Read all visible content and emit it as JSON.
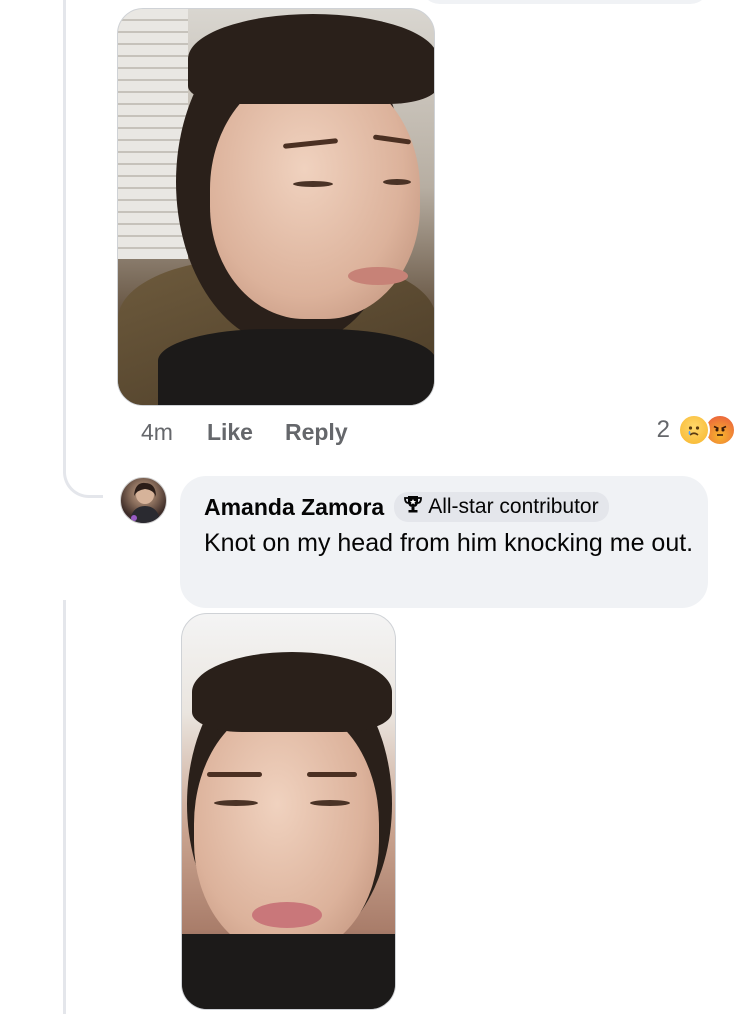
{
  "first_comment": {
    "timestamp": "4m",
    "like_label": "Like",
    "reply_label": "Reply",
    "reaction_count": "2",
    "reaction_icons": [
      "crying-face-icon",
      "angry-face-icon"
    ]
  },
  "reply_comment": {
    "author": "Amanda Zamora",
    "badge_label": "All-star contributor",
    "badge_icon": "trophy-icon",
    "text": "Knot on my head from him knocking me out."
  },
  "colors": {
    "bubble_bg": "#f0f2f5",
    "meta_text": "#65676b",
    "thread_line": "#e4e6eb"
  }
}
